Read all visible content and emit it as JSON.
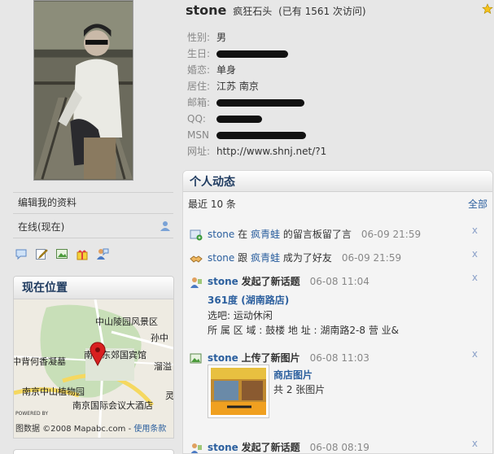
{
  "profile": {
    "username": "stone",
    "nickname": "疯狂石头",
    "visits_text": "(已有  1561 次访问)",
    "fields": [
      {
        "key": "性别:",
        "value": "男"
      },
      {
        "key": "生日:",
        "value": ""
      },
      {
        "key": "婚恋:",
        "value": "单身"
      },
      {
        "key": "居住:",
        "value": "江苏  南京"
      },
      {
        "key": "邮箱:",
        "value": ""
      },
      {
        "key": "QQ:",
        "value": ""
      },
      {
        "key": "MSN",
        "value": ""
      },
      {
        "key": "网址:",
        "value": "http://www.shnj.net/?1"
      }
    ]
  },
  "sidebar": {
    "edit_profile": "编辑我的资料",
    "online_status": "在线(现在)",
    "tool_icons": [
      "comment-icon",
      "edit-icon",
      "picture-icon",
      "gift-icon",
      "friend-icon"
    ]
  },
  "location": {
    "title": "现在位置",
    "map_labels": [
      "中山陵园风景区",
      "孙中",
      "中背何香凝墓",
      "南京东郊国宾馆",
      "溜溢",
      "南京中山植物园",
      "南京国际会议大酒店",
      "灵"
    ],
    "footer_text": "图数据 ©2008 Mapabc.com - ",
    "footer_link": "使用条款",
    "powered_by": "POWERED BY"
  },
  "feed": {
    "title": "个人动态",
    "subtitle": "最近  10 条",
    "all_link": "全部",
    "items": [
      {
        "icon": "message-board-icon",
        "actor": "stone",
        "pre": "在",
        "target": "疯青蛙",
        "post": "的留言板留了言",
        "time": "06-09 21:59",
        "close": "x"
      },
      {
        "icon": "handshake-icon",
        "actor": "stone",
        "pre": "跟",
        "target": "疯青蛙",
        "post": "成为了好友",
        "time": "06-09 21:59",
        "close": "x"
      },
      {
        "icon": "user-topic-icon",
        "actor": "stone",
        "action": "发起了新话题",
        "time": "06-08 11:04",
        "close": "x",
        "topic_title": "361度 (湖南路店)",
        "topic_lines": [
          "选吧: 运动休闲",
          "所 属 区 域 :   鼓楼      地          址 :   湖南路2-8 营 业&"
        ]
      },
      {
        "icon": "upload-picture-icon",
        "actor": "stone",
        "action": "上传了新图片",
        "time": "06-08 11:03",
        "close": "x",
        "album_name": "商店图片",
        "album_count": "共  2 张图片"
      },
      {
        "icon": "user-topic-icon",
        "actor": "stone",
        "action": "发起了新话题",
        "time": "06-08 08:19",
        "close": "x"
      }
    ]
  },
  "colors": {
    "link": "#2b5f9e",
    "heading": "#1f3b60",
    "background": "#e7e7e7",
    "map_pin": "#d92020"
  }
}
